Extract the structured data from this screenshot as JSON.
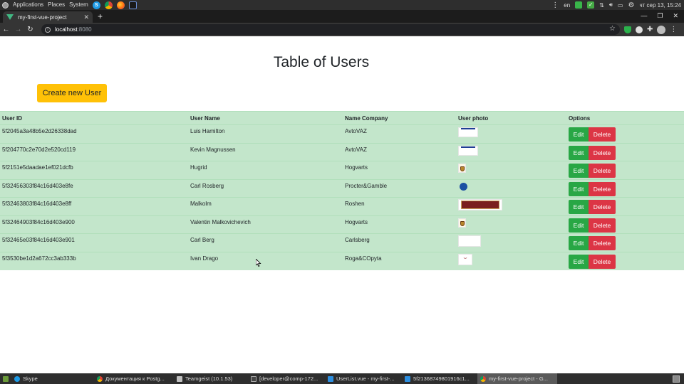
{
  "desktop_panel": {
    "menus": [
      "Applications",
      "Places",
      "System"
    ],
    "keyboard_layout": "en",
    "clock": "чт сер 13, 15:24"
  },
  "browser": {
    "tab_title": "my-first-vue-project",
    "new_tab_symbol": "+",
    "url_host": "localhost",
    "url_port": ":8080"
  },
  "page": {
    "title": "Table of Users",
    "create_button": "Create new User",
    "columns": [
      "User ID",
      "User Name",
      "Name Company",
      "User photo",
      "Options"
    ],
    "edit_label": "Edit",
    "delete_label": "Delete",
    "rows": [
      {
        "id": "5f2045a3a48b5e2d26338dad",
        "name": "Luis Hamilton",
        "company": "AvtoVAZ",
        "photo": "avtovaz-logo"
      },
      {
        "id": "5f204770c2e70d2e520cd119",
        "name": "Kevin Magnussen",
        "company": "AvtoVAZ",
        "photo": "avtovaz-logo"
      },
      {
        "id": "5f2151e5daadae1ef021dcfb",
        "name": "Hugrid",
        "company": "Hogvarts",
        "photo": "hogvarts-crest"
      },
      {
        "id": "5f32456303f84c16d403e8fe",
        "name": "Carl Rosberg",
        "company": "Procter&Gamble",
        "photo": "pg-logo"
      },
      {
        "id": "5f32463803f84c16d403e8ff",
        "name": "Malkolm",
        "company": "Roshen",
        "photo": "roshen-logo"
      },
      {
        "id": "5f32464903f84c16d403e900",
        "name": "Valentin Malkovichevich",
        "company": "Hogvarts",
        "photo": "hogvarts-crest"
      },
      {
        "id": "5f32465e03f84c16d403e901",
        "name": "Carl Berg",
        "company": "Carlsberg",
        "photo": "carlsberg-logo"
      },
      {
        "id": "5f3530be1d2a672cc3ab333b",
        "name": "Ivan Drago",
        "company": "Roga&COpyta",
        "photo": "roga-logo"
      }
    ]
  },
  "taskbar": {
    "items": [
      "Skype",
      "Документация к Postg...",
      "Teamgeist (10.1.53)",
      "[developer@comp-172...",
      "UserList.vue - my-first-...",
      "5f21368749801916c1...",
      "my-first-vue-project - G..."
    ]
  }
}
